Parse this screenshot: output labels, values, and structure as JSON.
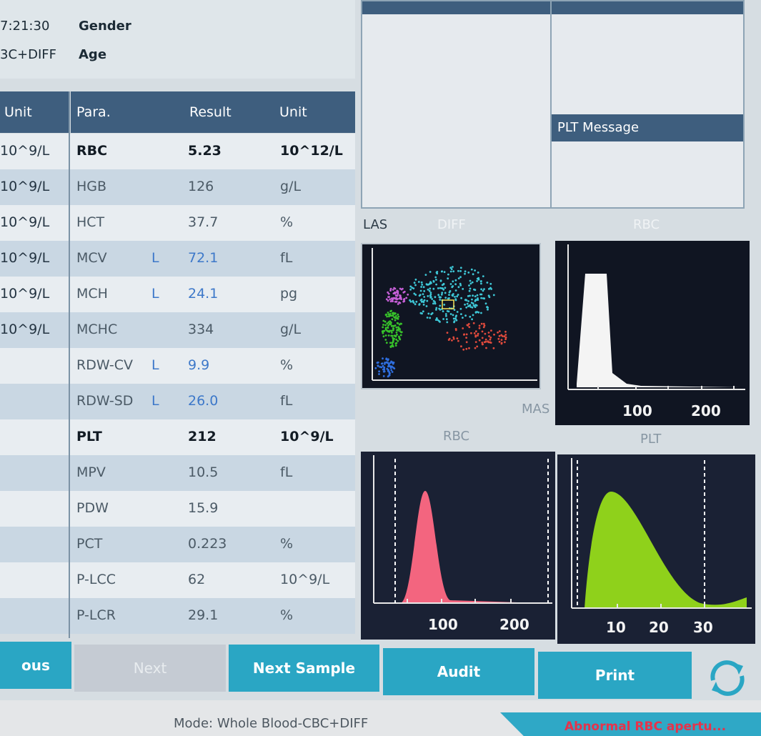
{
  "patient": {
    "time": "7:21:30",
    "mode_short": "3C+DIFF",
    "gender_label": "Gender",
    "age_label": "Age"
  },
  "left_table": {
    "unit_header": "Unit",
    "units": [
      "10^9/L",
      "10^9/L",
      "10^9/L",
      "10^9/L",
      "10^9/L",
      "10^9/L",
      "",
      "",
      "",
      "",
      "",
      "",
      "",
      "",
      ""
    ]
  },
  "main_table": {
    "headers": {
      "para": "Para.",
      "result": "Result",
      "unit": "Unit"
    },
    "rows": [
      {
        "para": "RBC",
        "flag": "",
        "result": "5.23",
        "unit": "10^12/L"
      },
      {
        "para": "HGB",
        "flag": "",
        "result": "126",
        "unit": "g/L"
      },
      {
        "para": "HCT",
        "flag": "",
        "result": "37.7",
        "unit": "%"
      },
      {
        "para": "MCV",
        "flag": "L",
        "result": "72.1",
        "unit": "fL"
      },
      {
        "para": "MCH",
        "flag": "L",
        "result": "24.1",
        "unit": "pg"
      },
      {
        "para": "MCHC",
        "flag": "",
        "result": "334",
        "unit": "g/L"
      },
      {
        "para": "RDW-CV",
        "flag": "L",
        "result": "9.9",
        "unit": "%"
      },
      {
        "para": "RDW-SD",
        "flag": "L",
        "result": "26.0",
        "unit": "fL"
      },
      {
        "para": "PLT",
        "flag": "",
        "result": "212",
        "unit": "10^9/L"
      },
      {
        "para": "MPV",
        "flag": "",
        "result": "10.5",
        "unit": "fL"
      },
      {
        "para": "PDW",
        "flag": "",
        "result": "15.9",
        "unit": ""
      },
      {
        "para": "PCT",
        "flag": "",
        "result": "0.223",
        "unit": "%"
      },
      {
        "para": "P-LCC",
        "flag": "",
        "result": "62",
        "unit": "10^9/L"
      },
      {
        "para": "P-LCR",
        "flag": "",
        "result": "29.1",
        "unit": "%"
      }
    ]
  },
  "messages": {
    "plt_title": "PLT Message"
  },
  "plots": {
    "diff_ylabel": "LAS",
    "diff_title": "DIFF",
    "diff_xlabel": "MAS",
    "rbc_title_top": "RBC",
    "rbc_hist_label": "RBC",
    "plt_hist_label": "PLT",
    "rbc_top_ticks": [
      "100",
      "200"
    ],
    "rbc_ticks": [
      "100",
      "200"
    ],
    "plt_ticks": [
      "10",
      "20",
      "30"
    ]
  },
  "buttons": {
    "previous": "ous",
    "next": "Next",
    "next_sample": "Next Sample",
    "audit": "Audit",
    "print": "Print"
  },
  "status": {
    "mode": "Mode: Whole Blood-CBC+DIFF",
    "alert": "Abnormal RBC apertu..."
  },
  "colors": {
    "header": "#3e5e7e",
    "button": "#2aa6c4",
    "low_value": "#3d78c9",
    "rbc_curve": "#f3657f",
    "plt_curve": "#8fd11b",
    "alert_bg": "#2fa8c6",
    "alert_text": "#e5334b"
  }
}
